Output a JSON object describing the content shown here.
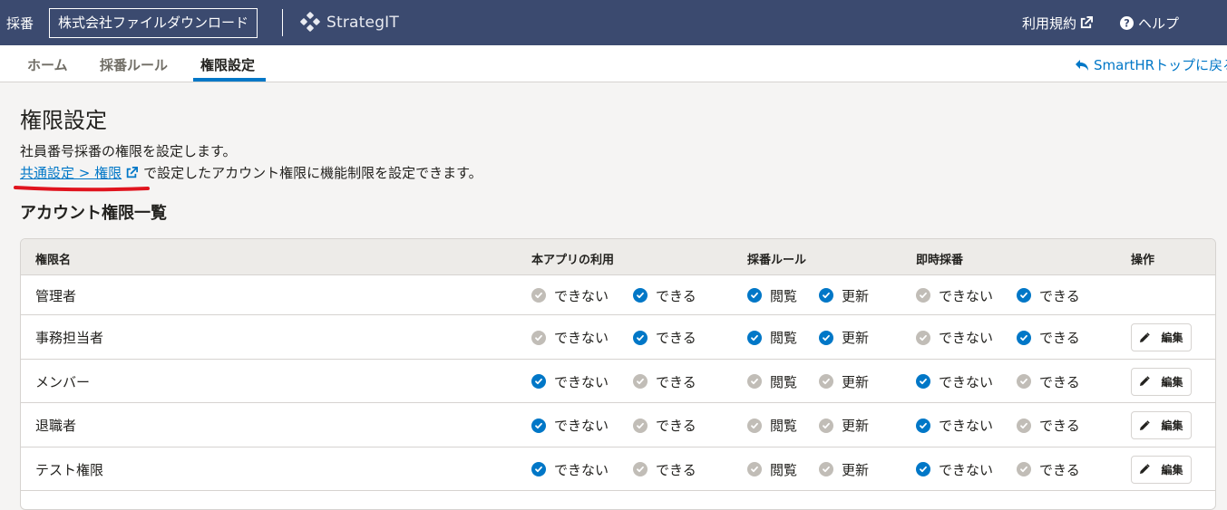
{
  "header": {
    "app_name": "採番",
    "company": "株式会社ファイルダウンロード",
    "logo_text": "StrategIT",
    "terms": "利用規約",
    "help": "ヘルプ"
  },
  "tabs": [
    {
      "label": "ホーム",
      "active": false
    },
    {
      "label": "採番ルール",
      "active": false
    },
    {
      "label": "権限設定",
      "active": true
    }
  ],
  "back_link": "SmartHRトップに戻る",
  "page": {
    "title": "権限設定",
    "description_line1": "社員番号採番の権限を設定します。",
    "link_text": "共通設定 > 権限",
    "description_line2_rest": "で設定したアカウント権限に機能制限を設定できます。",
    "section_title": "アカウント権限一覧"
  },
  "table": {
    "headers": {
      "name": "権限名",
      "app_use": "本アプリの利用",
      "rule": "採番ルール",
      "instant": "即時採番",
      "action": "操作"
    },
    "option_labels": {
      "cannot": "できない",
      "can": "できる",
      "view": "閲覧",
      "update": "更新"
    },
    "edit_label": "編集",
    "rows": [
      {
        "name": "管理者",
        "app_cannot": false,
        "app_can": true,
        "rule_view": true,
        "rule_update": true,
        "instant_cannot": false,
        "instant_can": true,
        "editable": false
      },
      {
        "name": "事務担当者",
        "app_cannot": false,
        "app_can": true,
        "rule_view": true,
        "rule_update": true,
        "instant_cannot": false,
        "instant_can": true,
        "editable": true
      },
      {
        "name": "メンバー",
        "app_cannot": true,
        "app_can": false,
        "rule_view": false,
        "rule_update": false,
        "instant_cannot": true,
        "instant_can": false,
        "editable": true
      },
      {
        "name": "退職者",
        "app_cannot": true,
        "app_can": false,
        "rule_view": false,
        "rule_update": false,
        "instant_cannot": true,
        "instant_can": false,
        "editable": true
      },
      {
        "name": "テスト権限",
        "app_cannot": true,
        "app_can": false,
        "rule_view": false,
        "rule_update": false,
        "instant_cannot": true,
        "instant_can": false,
        "editable": true
      }
    ]
  },
  "colors": {
    "header_bg": "#3b4a6f",
    "accent": "#0077c7",
    "check_on": "#0077c7",
    "check_off": "#c1bdb7",
    "annotation_underline": "#e0141e"
  },
  "icons": {
    "external_link": "external-link-icon",
    "help": "question-circle-icon",
    "back": "reply-arrow-icon",
    "check": "check-circle-icon",
    "edit": "pencil-icon"
  }
}
